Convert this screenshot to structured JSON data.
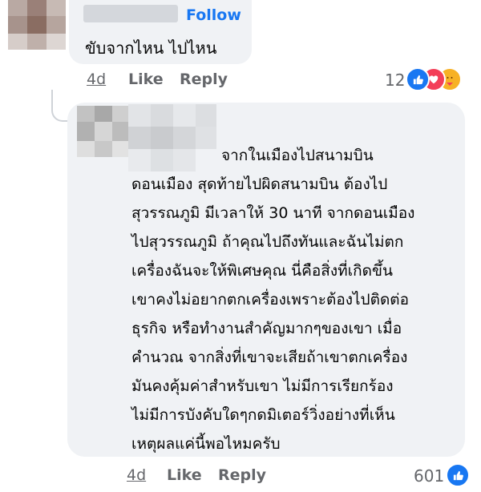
{
  "comment1": {
    "follow_label": "Follow",
    "text": "ขับจากไหน ไปไหน",
    "time": "4d",
    "like_label": "Like",
    "reply_label": "Reply",
    "reaction_count": "12",
    "reactions": [
      "like-icon",
      "love-icon",
      "care-icon"
    ]
  },
  "comment2": {
    "lines": [
      "จากในเมืองไปสนามบิน",
      "ดอนเมือง สุดท้ายไปผิดสนามบิน ต้องไป",
      "สุวรรณภูมิ มีเวลาให้ 30 นาที จากดอนเมือง",
      "ไปสุวรรณภูมิ ถ้าคุณไปถึงทันและฉันไม่ตก",
      "เครื่องฉันจะให้พิเศษคุณ นี่คือสิ่งที่เกิดขึ้น",
      "เขาคงไม่อยากตกเครื่องเพราะต้องไปติดต่อ",
      "ธุรกิจ หรือทำงานสำคัญมากๆของเขา เมื่อ",
      "คำนวณ จากสิ่งที่เขาจะเสียถ้าเขาตกเครื่อง",
      "มันคงคุ้มค่าสำหรับเขา ไม่มีการเรียกร้อง",
      "ไม่มีการบังคับใดๆกดมิเตอร์วิ่งอย่างที่เห็น",
      "เหตุผลแค่นี้พอไหมครับ"
    ],
    "time": "4d",
    "like_label": "Like",
    "reply_label": "Reply",
    "reaction_count": "601",
    "reactions": [
      "like-icon"
    ]
  },
  "colors": {
    "bubble": "#f0f2f5",
    "link": "#1877f2",
    "muted": "#65676b",
    "like": "#1877f2",
    "love": "#f33e58",
    "care": "#f7b125"
  }
}
